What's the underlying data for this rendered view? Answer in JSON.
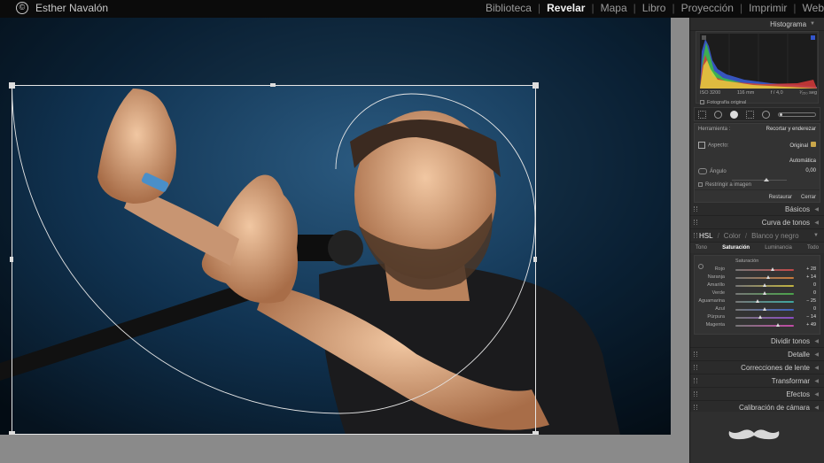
{
  "identity": {
    "name": "Esther Navalón",
    "copyright_symbol": "©"
  },
  "modules": [
    {
      "label": "Biblioteca",
      "active": false
    },
    {
      "label": "Revelar",
      "active": true
    },
    {
      "label": "Mapa",
      "active": false
    },
    {
      "label": "Libro",
      "active": false
    },
    {
      "label": "Proyección",
      "active": false
    },
    {
      "label": "Imprimir",
      "active": false
    },
    {
      "label": "Web",
      "active": false
    }
  ],
  "histogram": {
    "title": "Histograma",
    "iso": "ISO 3200",
    "focal": "116 mm",
    "aperture": "f / 4,0",
    "shutter": "¹⁄₂₅₀ seg",
    "original_label": "Fotografía original"
  },
  "crop_tool": {
    "tool_label": "Herramienta :",
    "tool_value": "Recortar y enderezar",
    "aspect_label": "Aspecto:",
    "aspect_value": "Original",
    "auto_label": "Automática",
    "angle_label": "Ángulo",
    "angle_value": "0,00",
    "constrain_label": "Restringir a imagen",
    "reset_label": "Restaurar",
    "close_label": "Cerrar"
  },
  "panels": {
    "basic": "Básicos",
    "tone_curve": "Curva de tonos",
    "split_toning": "Dividir tonos",
    "detail": "Detalle",
    "lens": "Correcciones de lente",
    "transform": "Transformar",
    "effects": "Efectos",
    "calibration": "Calibración de cámara"
  },
  "hsl": {
    "tab_hsl": "HSL",
    "tab_color": "Color",
    "tab_bw": "Blanco y negro",
    "subtabs": [
      "Tono",
      "Saturación",
      "Luminancia",
      "Todo"
    ],
    "section_title": "Saturación",
    "rows": [
      {
        "label": "Rojo",
        "value": "+ 28",
        "pos": 0.64,
        "color": "#c24848"
      },
      {
        "label": "Naranja",
        "value": "+ 14",
        "pos": 0.57,
        "color": "#c77a3a"
      },
      {
        "label": "Amarillo",
        "value": "0",
        "pos": 0.5,
        "color": "#c2b440"
      },
      {
        "label": "Verde",
        "value": "0",
        "pos": 0.5,
        "color": "#4aa34a"
      },
      {
        "label": "Aguamarina",
        "value": "− 25",
        "pos": 0.38,
        "color": "#3fa7a0"
      },
      {
        "label": "Azul",
        "value": "0",
        "pos": 0.5,
        "color": "#4062c2"
      },
      {
        "label": "Púrpura",
        "value": "− 14",
        "pos": 0.43,
        "color": "#8a4cc2"
      },
      {
        "label": "Magenta",
        "value": "+ 49",
        "pos": 0.74,
        "color": "#c24aa6"
      }
    ]
  }
}
